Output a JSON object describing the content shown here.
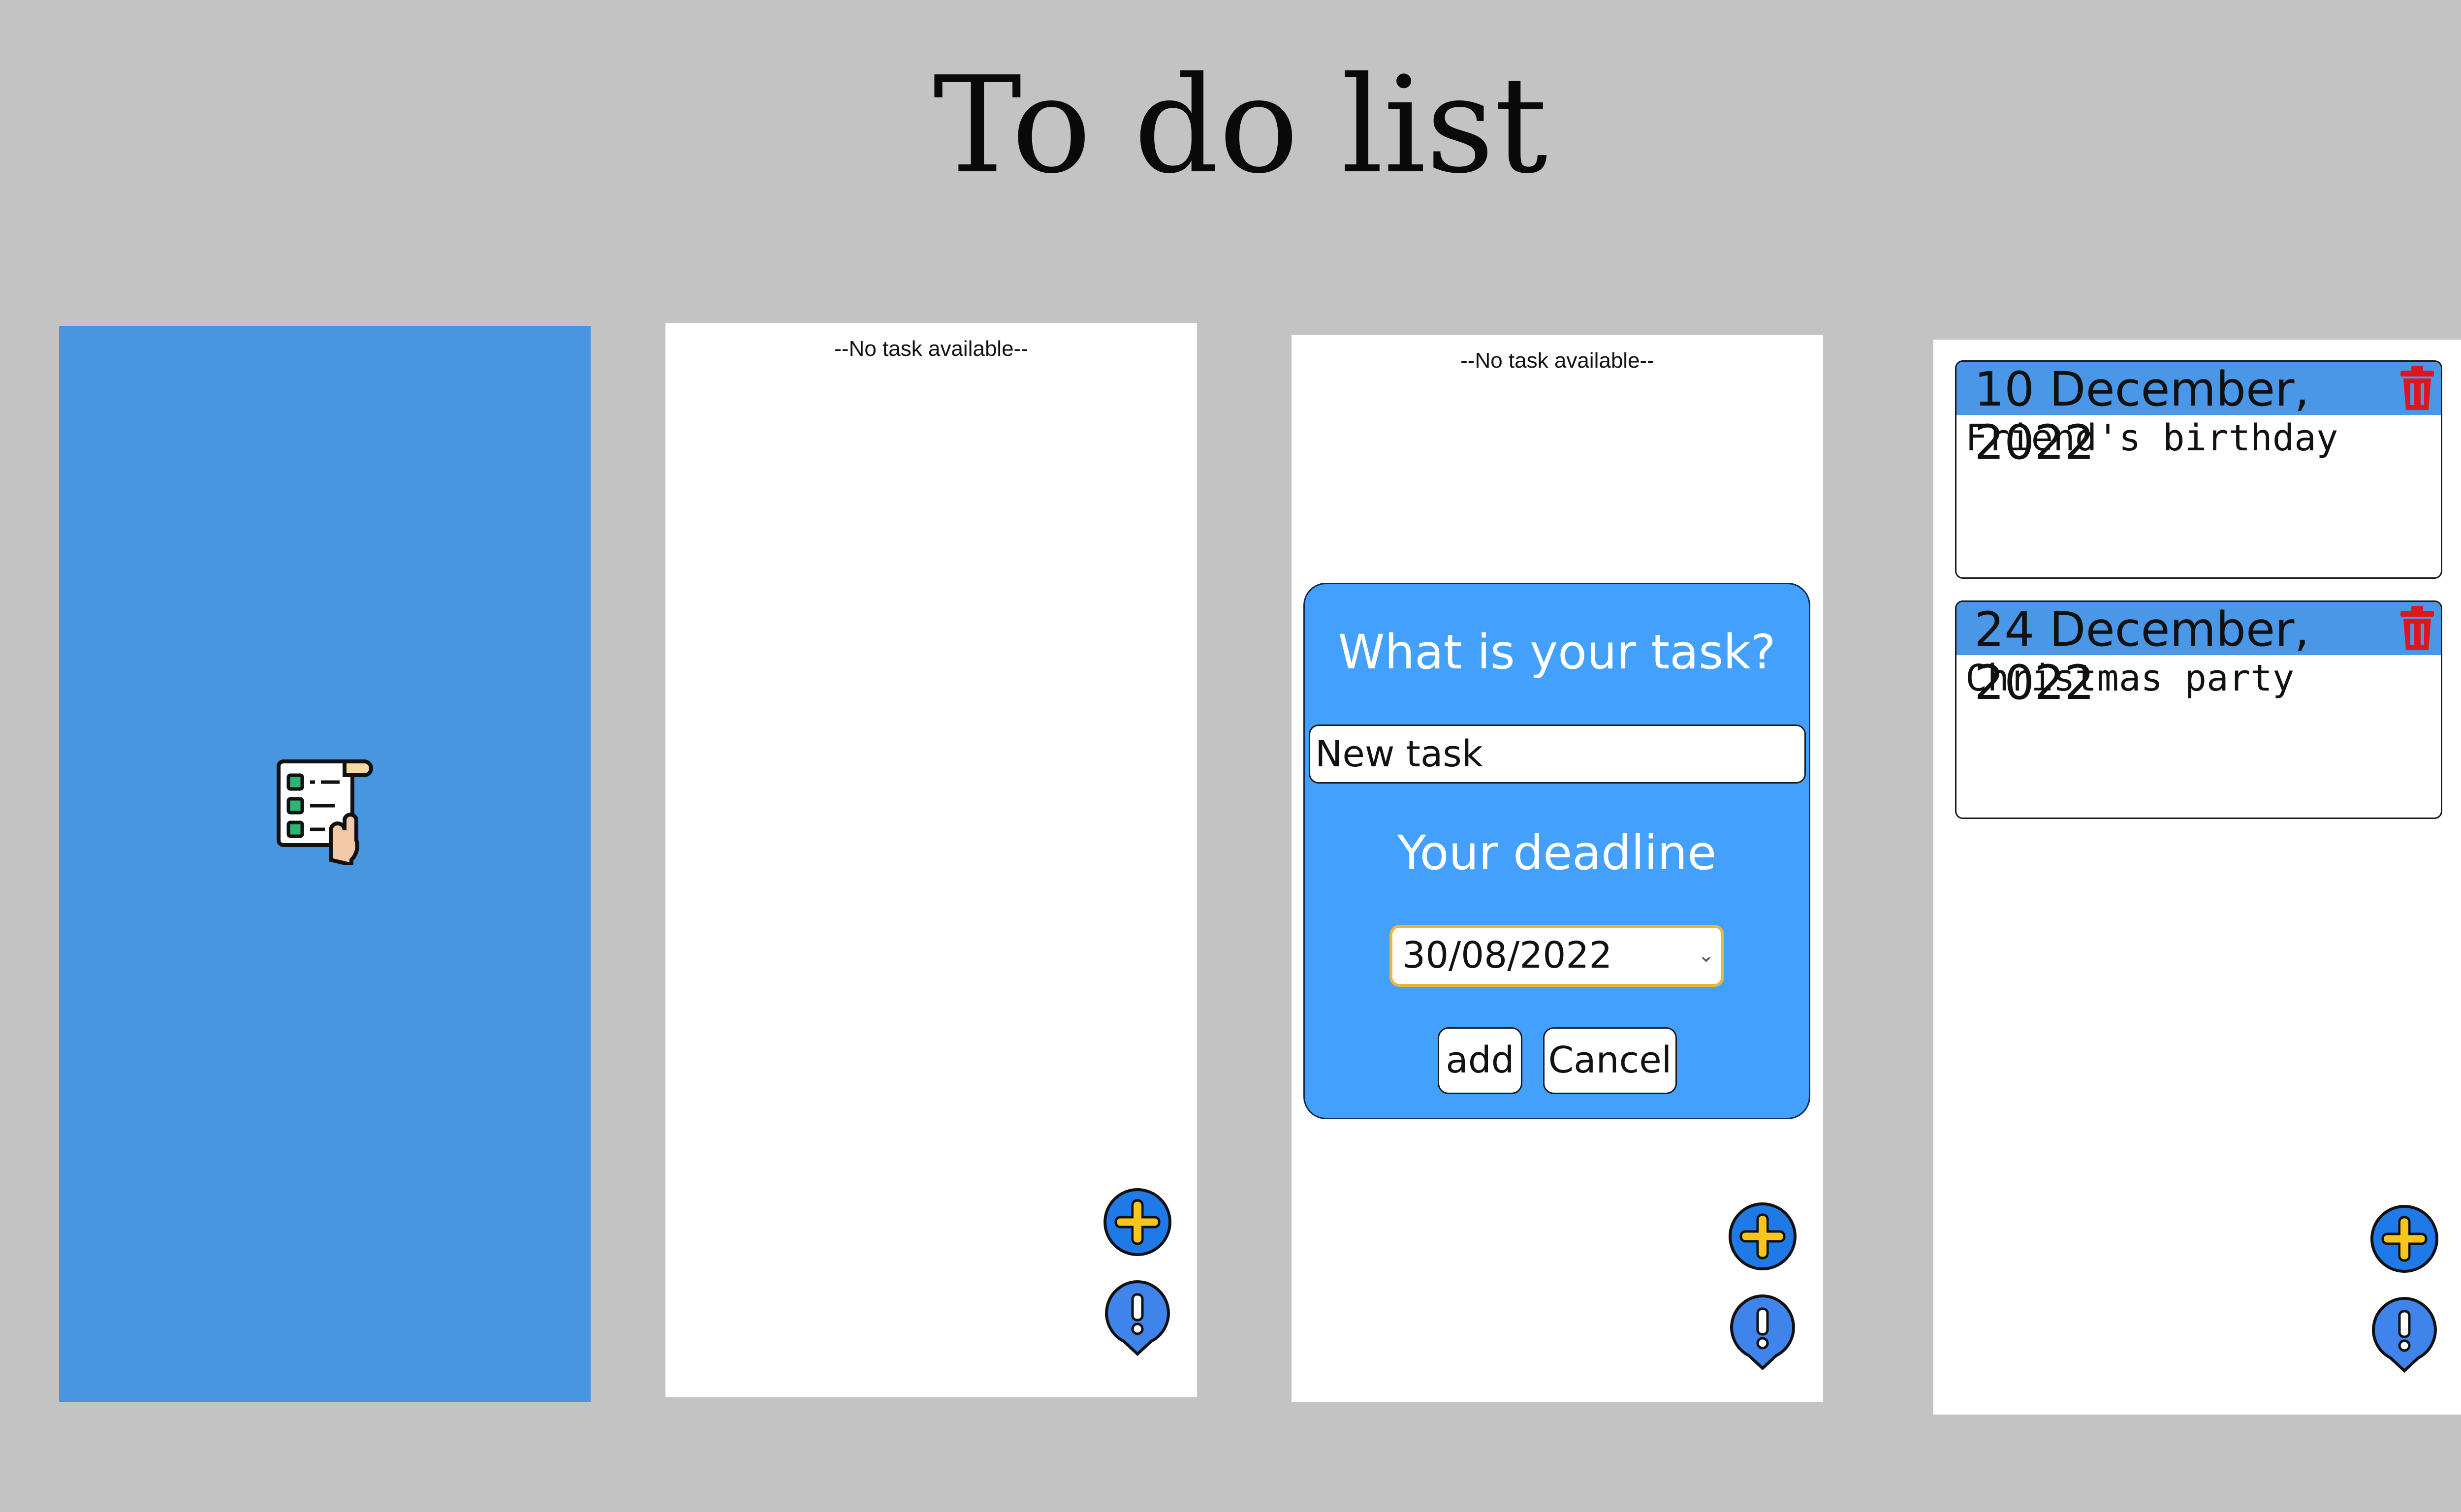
{
  "page": {
    "title": "To do list"
  },
  "screen2": {
    "empty_message": "--No task available--"
  },
  "screen3": {
    "empty_message": "--No task available--",
    "dialog": {
      "title": "What is your task?",
      "task_input_value": "New task",
      "deadline_label": "Your deadline",
      "deadline_value": "30/08/2022",
      "add_label": "add",
      "cancel_label": "Cancel"
    }
  },
  "screen4": {
    "tasks": [
      {
        "date": "10 December, 2022",
        "text": "Friend's birthday"
      },
      {
        "date": "24 December, 2022",
        "text": "Christmas party"
      }
    ]
  },
  "icons": {
    "splash": "todo-list-hand-icon",
    "add": "plus-icon",
    "info": "exclamation-icon",
    "delete": "trash-icon"
  },
  "colors": {
    "background": "#c3c3c3",
    "splash": "#4895e0",
    "dialog": "#43a0fc",
    "task_header": "#4b97e7",
    "fab_fill": "#1f7ae8",
    "plus": "#f7c51c",
    "trash": "#e0161e"
  }
}
